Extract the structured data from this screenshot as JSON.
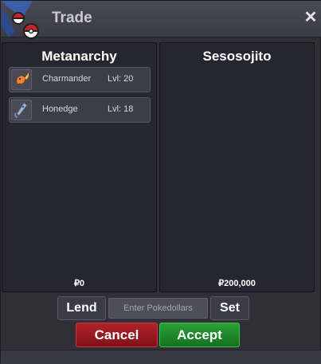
{
  "window": {
    "title": "Trade",
    "close_glyph": "✕"
  },
  "left_panel": {
    "trainer": "Metanarchy",
    "pokemon": [
      {
        "name": "Charmander",
        "level": "Lvl: 20",
        "icon": "charmander-icon"
      },
      {
        "name": "Honedge",
        "level": "Lvl: 18",
        "icon": "honedge-icon"
      }
    ],
    "money": "₽0"
  },
  "right_panel": {
    "trainer": "Sesosojito",
    "money": "₽200,000"
  },
  "controls": {
    "lend_label": "Lend",
    "money_placeholder": "Enter Pokedollars",
    "set_label": "Set",
    "cancel_label": "Cancel",
    "accept_label": "Accept"
  },
  "colors": {
    "cancel": "#a51d23",
    "accept": "#23913a",
    "panel": "#262630"
  }
}
